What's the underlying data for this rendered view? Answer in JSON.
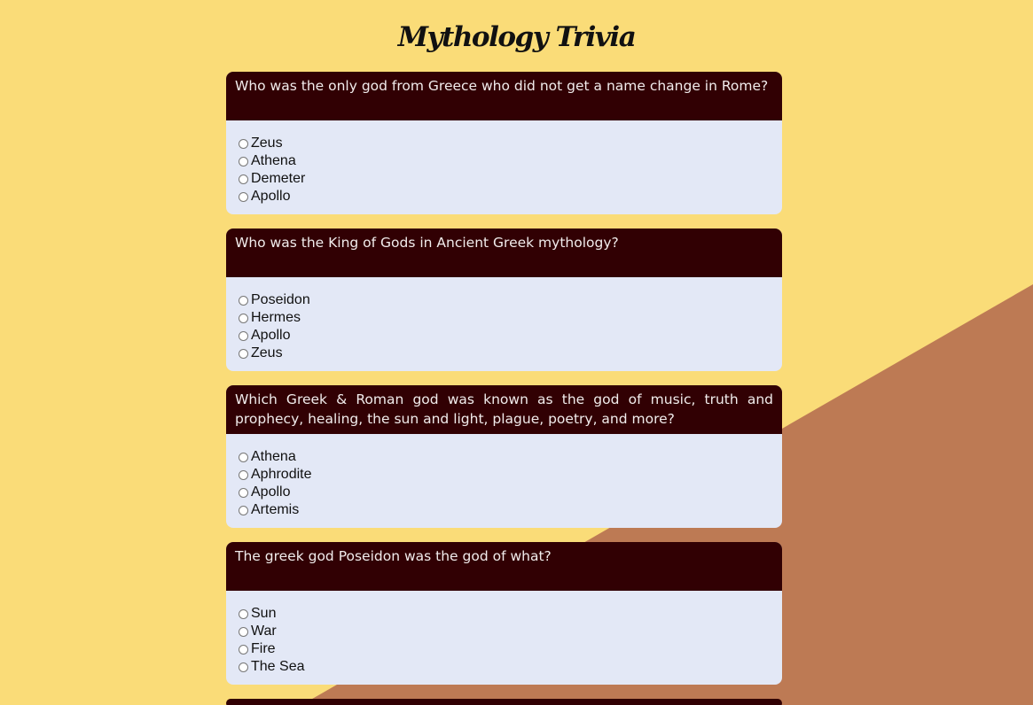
{
  "page": {
    "title": "Mythology Trivia"
  },
  "colors": {
    "background": "#fadc78",
    "diagonal": "#bd7a54",
    "question_bg": "#310003",
    "card_bg": "#e3e8f6"
  },
  "questions": [
    {
      "text": "Who was the only god from Greece who did not get a name change in Rome?",
      "options": [
        "Zeus",
        "Athena",
        "Demeter",
        "Apollo"
      ]
    },
    {
      "text": "Who was the King of Gods in Ancient Greek mythology?",
      "options": [
        "Poseidon",
        "Hermes",
        "Apollo",
        "Zeus"
      ]
    },
    {
      "text": "Which Greek & Roman god was known as the god of music, truth and prophecy, healing, the sun and light, plague, poetry, and more?",
      "options": [
        "Athena",
        "Aphrodite",
        "Apollo",
        "Artemis"
      ]
    },
    {
      "text": "The greek god Poseidon was the god of what?",
      "options": [
        "Sun",
        "War",
        "Fire",
        "The Sea"
      ]
    }
  ]
}
